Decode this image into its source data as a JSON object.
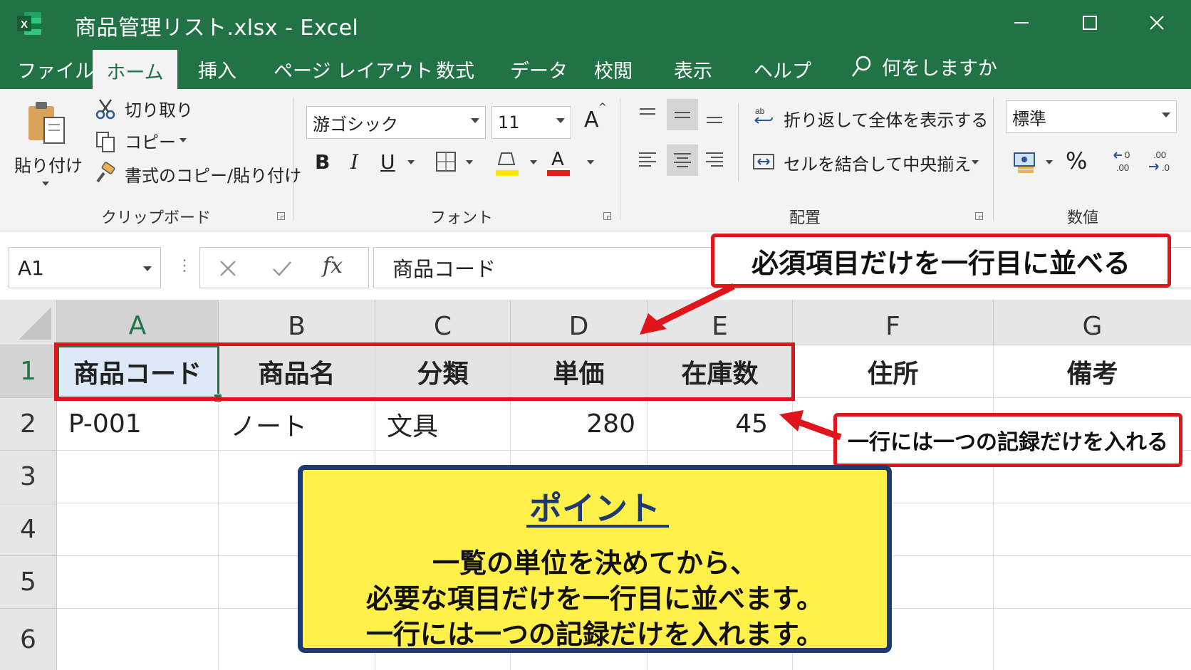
{
  "window": {
    "title": "商品管理リスト.xlsx  -  Excel",
    "app_icon": "excel-icon",
    "controls": [
      "minimize-icon",
      "maximize-icon",
      "close-icon"
    ]
  },
  "menu": {
    "tabs": [
      "ファイル",
      "ホーム",
      "挿入",
      "ページ レイアウト",
      "数式",
      "データ",
      "校閲",
      "表示",
      "ヘルプ"
    ],
    "active_tab": "ホーム",
    "tell_me": "何をしますか"
  },
  "ribbon": {
    "clipboard": {
      "paste": "貼り付け",
      "cut": "切り取り",
      "copy": "コピー",
      "format_painter": "書式のコピー/貼り付け",
      "label": "クリップボード"
    },
    "font": {
      "font_name": "游ゴシック",
      "font_size": "11",
      "bold": "B",
      "italic": "I",
      "underline": "U",
      "font_color_glyph": "A",
      "grow_glyph": "A",
      "label": "フォント"
    },
    "alignment": {
      "wrap_text": "折り返して全体を表示する",
      "merge_center": "セルを結合して中央揃え",
      "label": "配置"
    },
    "number": {
      "format": "標準",
      "percent": "%",
      "label": "数値"
    }
  },
  "formula_bar": {
    "name_box": "A1",
    "fx": "fx",
    "value": "商品コード"
  },
  "sheet": {
    "columns": [
      "A",
      "B",
      "C",
      "D",
      "E",
      "F",
      "G"
    ],
    "rows": [
      "1",
      "2",
      "3",
      "4",
      "5",
      "6"
    ],
    "row1": [
      "商品コード",
      "商品名",
      "分類",
      "単価",
      "在庫数",
      "住所",
      "備考"
    ],
    "row2": [
      "P-001",
      "ノート",
      "文具",
      "280",
      "45"
    ],
    "selected_cell": "A1"
  },
  "annotations": {
    "header_callout": "必須項目だけを一行目に並べる",
    "record_callout": "一行には一つの記録だけを入れる",
    "point_title": "ポイント",
    "point_lines": [
      "一覧の単位を決めてから、",
      "必要な項目だけを一行目に並べます。",
      "一行には一つの記録だけを入れます。"
    ]
  },
  "colors": {
    "excel_green": "#217346",
    "callout_red": "#e0141b",
    "point_yellow": "#fff04a",
    "point_navy": "#1f3a73"
  }
}
